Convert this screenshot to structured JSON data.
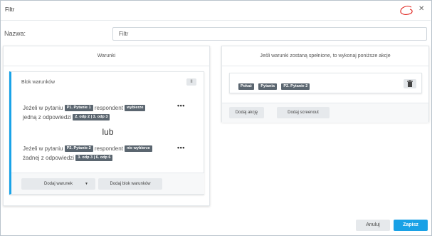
{
  "dialog": {
    "title": "Filtr",
    "close_icon": "close-icon"
  },
  "name_field": {
    "label": "Nazwa:",
    "value": "Filtr"
  },
  "conditions_panel": {
    "header": "Warunki",
    "block": {
      "title": "Blok warunków",
      "pause_label": "II",
      "conditions": [
        {
          "prefix": "Jeżeli w pytaniu",
          "question_tag": "P1. Pytanie 1",
          "middle": "respondent",
          "verb_tag": "wybierze",
          "answers_prefix": "jedną z odpowiedzi",
          "answers_tag": "2. odp 2 | 3. odp 3",
          "menu_label": "•••"
        },
        {
          "prefix": "Jeżeli w pytaniu",
          "question_tag": "P2. Pytanie 2",
          "middle": "respondent",
          "verb_tag": "nie wybierze",
          "answers_prefix": "żadnej z odpowiedzi",
          "answers_tag": "3. odp 3 | 6. odp 6",
          "menu_label": "•••"
        }
      ],
      "separator": "lub",
      "add_condition_label": "Dodaj warunek",
      "add_condition_caret": "▼",
      "add_block_label": "Dodaj blok warunków"
    }
  },
  "actions_panel": {
    "header": "Jeśli warunki zostaną spełnione, to wykonaj poniższe akcje",
    "action_tags": [
      "Pokaż",
      "Pytania",
      "P2. Pytanie 2"
    ],
    "delete_icon": "trash-icon",
    "add_action_label": "Dodaj akcję",
    "add_screenout_label": "Dodaj screenout"
  },
  "footer": {
    "cancel_label": "Anuluj",
    "save_label": "Zapisz"
  },
  "colors": {
    "accent": "#19a1e6",
    "tag_bg": "#5b6670",
    "annotation_red": "#e0201b"
  }
}
